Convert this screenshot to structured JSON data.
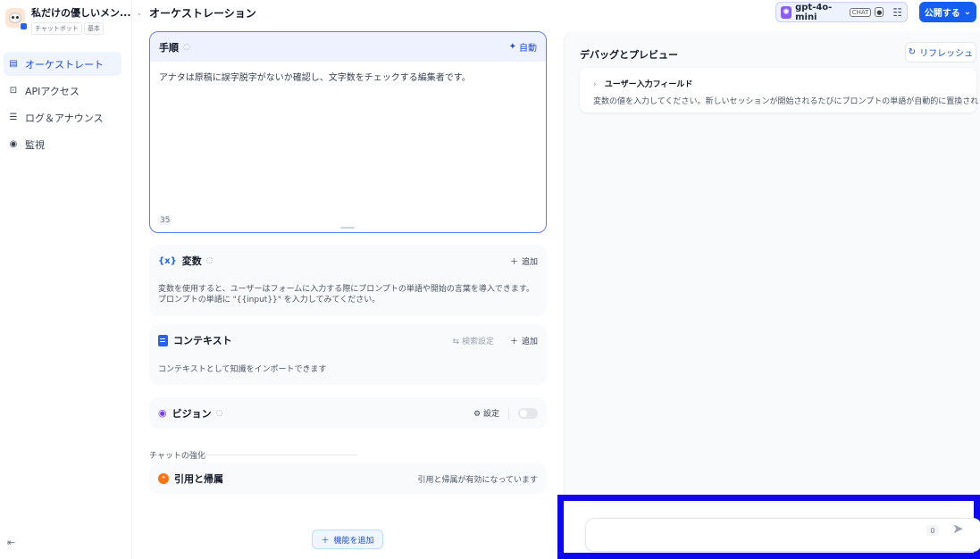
{
  "app": {
    "title": "私だけの優しいメン...",
    "tags": [
      "チャットボット",
      "基本"
    ]
  },
  "nav": {
    "items": [
      {
        "label": "オーケストレート",
        "icon": "orchestrate-icon",
        "active": true
      },
      {
        "label": "APIアクセス",
        "icon": "api-terminal-icon",
        "active": false
      },
      {
        "label": "ログ＆アナウンス",
        "icon": "log-icon",
        "active": false
      },
      {
        "label": "監視",
        "icon": "monitor-icon",
        "active": false
      }
    ]
  },
  "header": {
    "page_title": "オーケストレーション",
    "model_name": "gpt-4o-mini",
    "model_badge": "CHAT",
    "publish_label": "公開する"
  },
  "prompt": {
    "title": "手順",
    "auto_label": "自動",
    "text": "アナタは原稿に誤字脱字がないか確認し、文字数をチェックする編集者です。",
    "char_count": "35"
  },
  "variables": {
    "title": "変数",
    "add_label": "追加",
    "description": "変数を使用すると、ユーザーはフォームに入力する際にプロンプトの単語や開始の言葉を導入できます。プロンプトの単語に \"{{input}}\" を入力してみてください。"
  },
  "context": {
    "title": "コンテキスト",
    "retrieval_label": "検索設定",
    "add_label": "追加",
    "description": "コンテキストとして知識をインポートできます"
  },
  "vision": {
    "title": "ビジョン",
    "settings_label": "設定",
    "enabled": false
  },
  "enhance": {
    "section_label": "チャットの強化",
    "citation_title": "引用と帰属",
    "citation_status": "引用と帰属が有効になっています"
  },
  "add_feature_label": "機能を追加",
  "debug": {
    "title": "デバッグとプレビュー",
    "refresh_label": "リフレッシュ",
    "user_fields_title": "ユーザー入力フィールド",
    "user_fields_desc": "変数の値を入力してください。新しいセッションが開始されるたびにプロンプトの単語が自動的に置換されます。",
    "chat_count": "0",
    "chat_placeholder": ""
  },
  "colors": {
    "accent": "#155eef",
    "highlight_frame": "#0d08ee"
  }
}
